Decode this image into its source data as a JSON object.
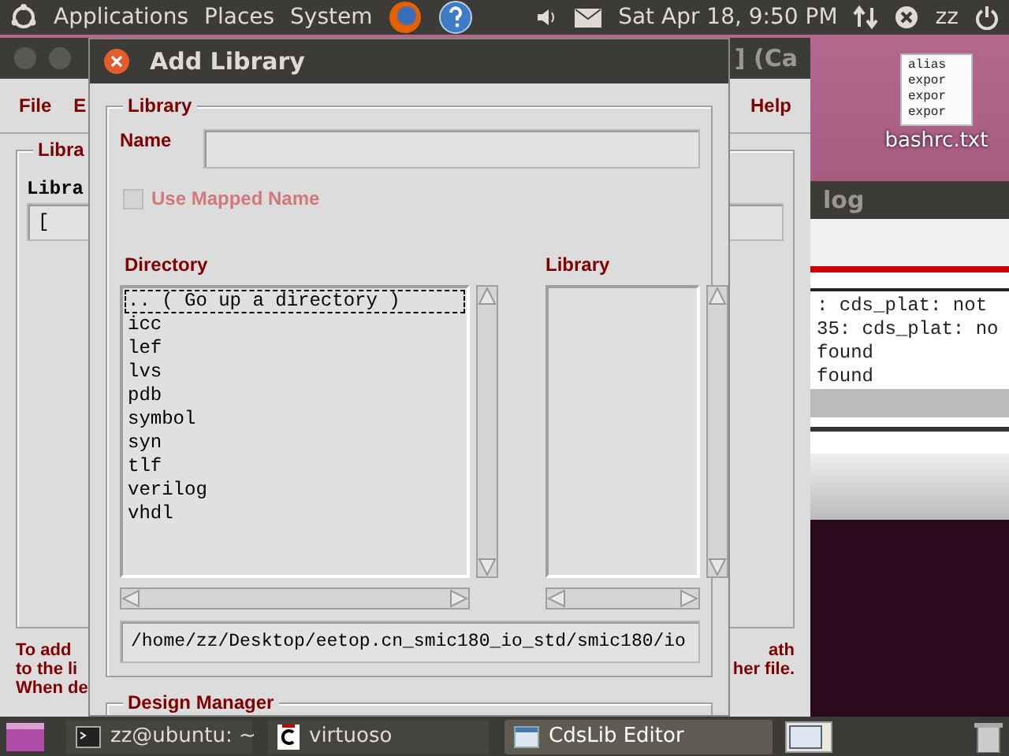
{
  "top_panel": {
    "menus": [
      "Applications",
      "Places",
      "System"
    ],
    "clock": "Sat Apr 18,  9:50 PM",
    "user": "zz"
  },
  "desktop_icon": {
    "label": "bashrc.txt",
    "preview_lines": [
      "alias",
      "expor",
      "expor",
      "expor"
    ]
  },
  "background_window": {
    "title": "] (Ca",
    "menus": [
      "File",
      "E",
      "Help"
    ],
    "group_label": "Libra",
    "column_label": "Libra",
    "field_value": "[",
    "help_left": [
      "To add",
      "to the li",
      "When de"
    ],
    "help_right": [
      "ath",
      "her file."
    ]
  },
  "log_window": {
    "title": "log",
    "lines": [
      ": cds_plat: not",
      "35: cds_plat: no",
      "found",
      "found"
    ]
  },
  "dialog": {
    "title": "Add Library",
    "library_group": "Library",
    "name_label": "Name",
    "use_mapped_name": {
      "label": "Use Mapped Name",
      "checked": false,
      "disabled": true
    },
    "directory_label": "Directory",
    "directory_items": [
      {
        "label": ".. ( Go up a directory )",
        "focused": true
      },
      {
        "label": "icc",
        "focused": false
      },
      {
        "label": "lef",
        "focused": false
      },
      {
        "label": "lvs",
        "focused": false
      },
      {
        "label": "pdb",
        "focused": false
      },
      {
        "label": "symbol",
        "focused": false
      },
      {
        "label": "syn",
        "focused": false
      },
      {
        "label": "tlf",
        "focused": false
      },
      {
        "label": "verilog",
        "focused": false
      },
      {
        "label": "vhdl",
        "focused": false
      }
    ],
    "library_label": "Library",
    "path": "/home/zz/Desktop/eetop.cn_smic180_io_std/smic180/io",
    "design_manager_group": "Design Manager"
  },
  "taskbar": {
    "tasks": [
      {
        "label": "zz@ubuntu: ~",
        "kind": "terminal",
        "selected": false
      },
      {
        "label": "virtuoso",
        "kind": "app",
        "selected": false
      },
      {
        "label": "CdsLib Editor",
        "kind": "window",
        "selected": true
      }
    ]
  }
}
